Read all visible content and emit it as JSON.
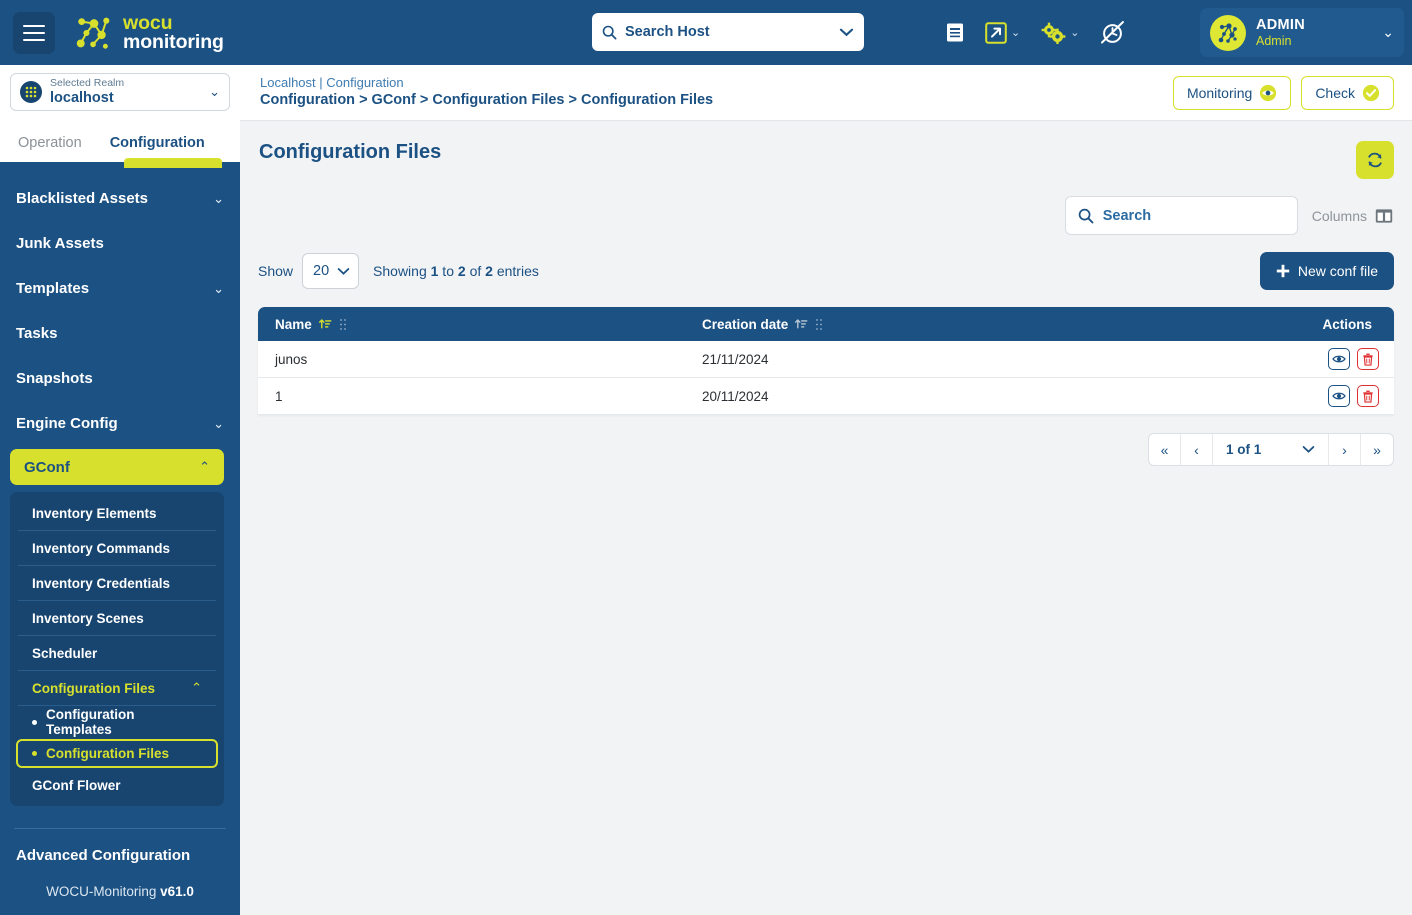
{
  "topbar": {
    "brand_line1": "wocu",
    "brand_line2": "monitoring",
    "search_host_text": "Search Host",
    "icons": [
      {
        "name": "docs-icon"
      },
      {
        "name": "external-link-icon"
      },
      {
        "name": "gears-icon"
      },
      {
        "name": "silence-icon"
      }
    ],
    "user": {
      "name": "ADMIN",
      "role": "Admin"
    }
  },
  "sidebar": {
    "realm_label": "Selected Realm",
    "realm_value": "localhost",
    "tabs": [
      {
        "label": "Operation",
        "active": false
      },
      {
        "label": "Configuration",
        "active": true
      }
    ],
    "items": [
      {
        "label": "Blacklisted Assets",
        "expandable": true
      },
      {
        "label": "Junk Assets",
        "expandable": false
      },
      {
        "label": "Templates",
        "expandable": true
      },
      {
        "label": "Tasks",
        "expandable": false
      },
      {
        "label": "Snapshots",
        "expandable": false
      },
      {
        "label": "Engine Config",
        "expandable": true
      }
    ],
    "gconf": {
      "label": "GConf"
    },
    "submenu": [
      {
        "label": "Inventory Elements",
        "type": "sub"
      },
      {
        "label": "Inventory Commands",
        "type": "sub"
      },
      {
        "label": "Inventory Credentials",
        "type": "sub"
      },
      {
        "label": "Inventory Scenes",
        "type": "sub"
      },
      {
        "label": "Scheduler",
        "type": "sub"
      },
      {
        "label": "Configuration Files",
        "type": "sub-accent"
      },
      {
        "label": "Configuration Templates",
        "type": "leaf"
      },
      {
        "label": "Configuration Files",
        "type": "leaf-selected"
      },
      {
        "label": "GConf Flower",
        "type": "plain"
      }
    ],
    "advanced_configuration": "Advanced Configuration",
    "version_product": "WOCU-Monitoring",
    "version_number": "v61.0"
  },
  "breadcrumb": {
    "top": "Localhost | Configuration",
    "path": "Configuration > GConf > Configuration Files > Configuration Files",
    "monitoring_btn": "Monitoring",
    "check_btn": "Check"
  },
  "page": {
    "title": "Configuration Files",
    "search_placeholder": "Search",
    "columns_label": "Columns",
    "show_label": "Show",
    "show_value": "20",
    "entries_text_1": "Showing ",
    "entries_from": "1",
    "entries_text_2": " to ",
    "entries_to": "2",
    "entries_text_3": " of ",
    "entries_total": "2",
    "entries_text_4": " entries",
    "new_button": "New conf file"
  },
  "table": {
    "columns": [
      "Name",
      "Creation date",
      "Actions"
    ],
    "rows": [
      {
        "name": "junos",
        "creation_date": "21/11/2024"
      },
      {
        "name": "1",
        "creation_date": "20/11/2024"
      }
    ]
  },
  "pagination": {
    "page_text": "1 of 1",
    "first": "«",
    "prev": "‹",
    "next": "›",
    "last": "»"
  },
  "colors": {
    "brand_blue": "#1c5183",
    "accent_lime": "#d7e02c",
    "danger_red": "#e03131"
  }
}
